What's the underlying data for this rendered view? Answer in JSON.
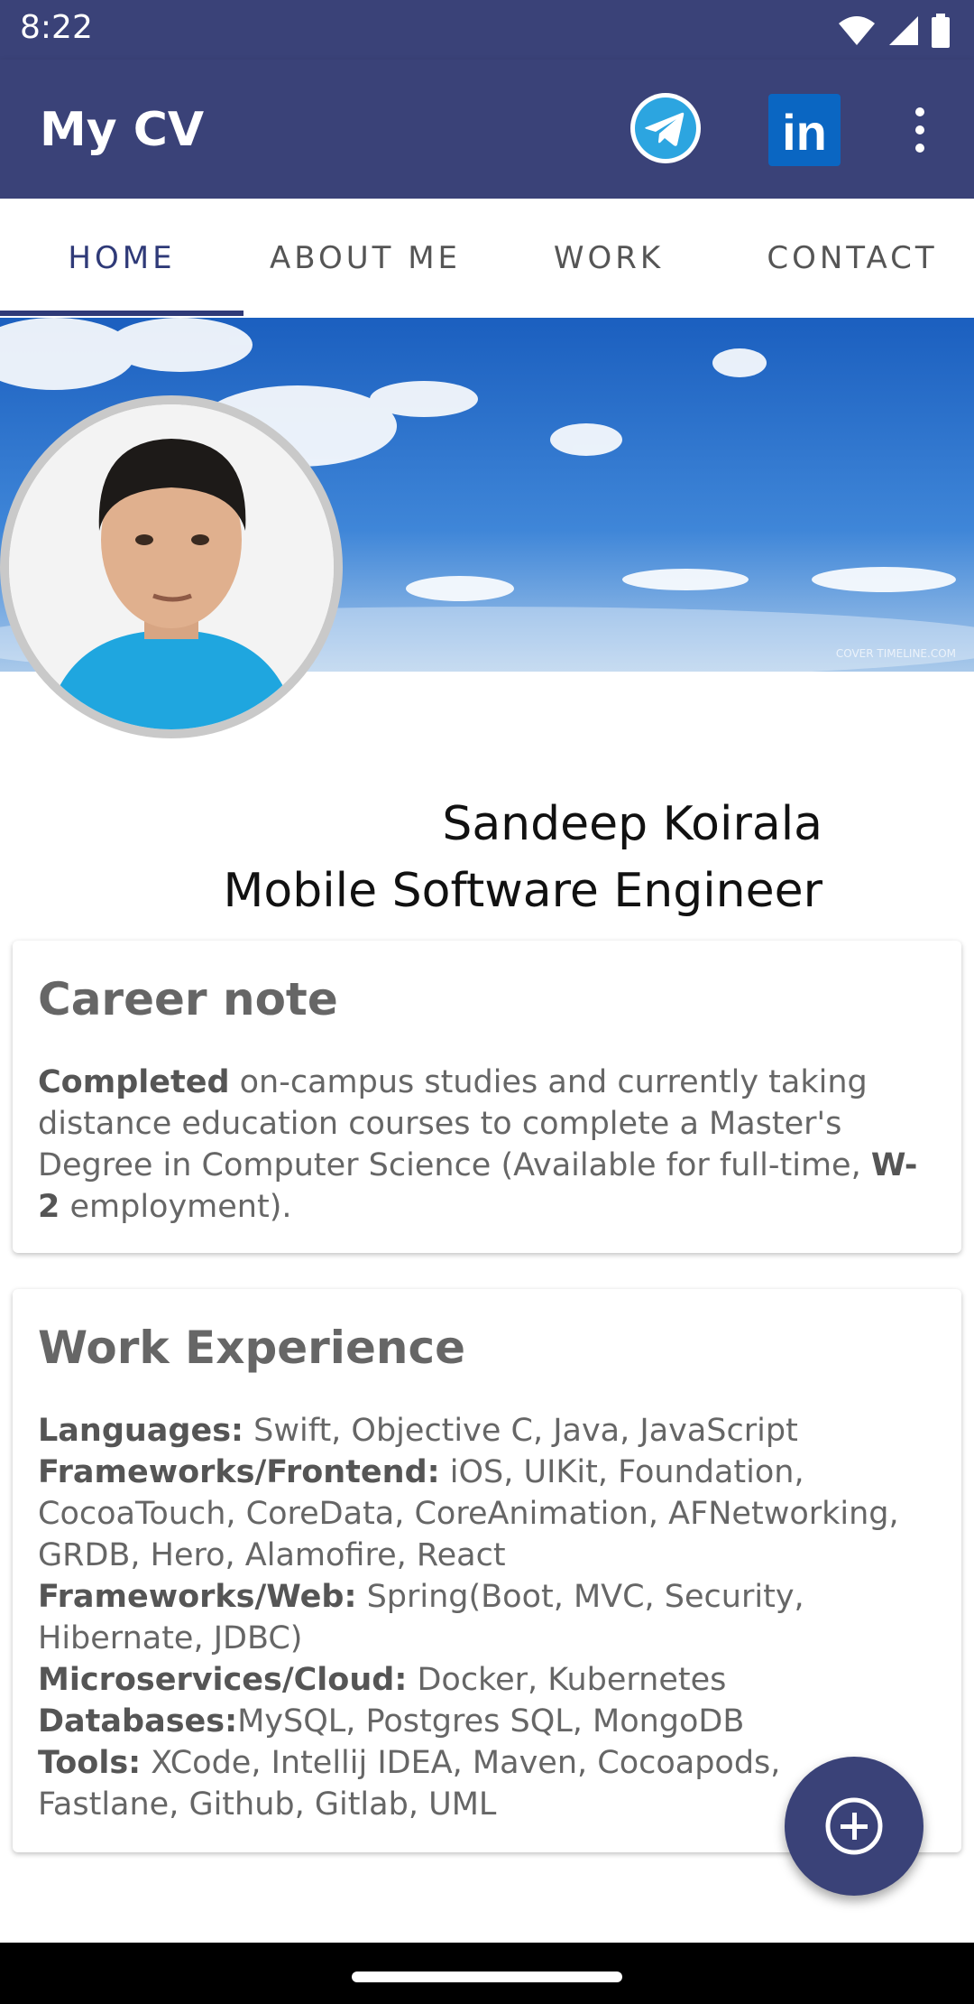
{
  "status_bar": {
    "time": "8:22"
  },
  "app_bar": {
    "title": "My CV",
    "linkedin_text": "in"
  },
  "tabs": [
    {
      "label": "HOME"
    },
    {
      "label": "ABOUT ME"
    },
    {
      "label": "WORK"
    },
    {
      "label": "CONTACT"
    }
  ],
  "banner": {
    "watermark": "COVER TIMELINE.COM"
  },
  "profile": {
    "name": "Sandeep Koirala",
    "role": "Mobile Software Engineer"
  },
  "career_note": {
    "heading": "Career note",
    "bold_1": "Completed",
    "text_1": " on-campus studies and currently taking distance education courses to complete a Master's Degree in Computer Science (Available for full-time, ",
    "bold_2": "W-2",
    "text_2": " employment)."
  },
  "work_experience": {
    "heading": "Work Experience",
    "lines": [
      {
        "label": "Languages:",
        "value": " Swift, Objective C, Java, JavaScript"
      },
      {
        "label": "Frameworks/Frontend:",
        "value": " iOS, UIKit, Foundation, CocoaTouch, CoreData, CoreAnimation, AFNetworking, GRDB, Hero, Alamofire, React"
      },
      {
        "label": "Frameworks/Web:",
        "value": " Spring(Boot, MVC, Security, Hibernate, JDBC)"
      },
      {
        "label": "Microservices/Cloud:",
        "value": " Docker, Kubernetes"
      },
      {
        "label": "Databases:",
        "value": "MySQL, Postgres SQL, MongoDB"
      },
      {
        "label": "Tools:",
        "value": " XCode, Intellij IDEA, Maven, Cocoapods, Fastlane, Github, Gitlab, UML"
      }
    ]
  },
  "colors": {
    "primary": "#3a4278",
    "tab_active": "#2f3a78",
    "telegram": "#2ca5e0",
    "linkedin": "#0a66c2"
  },
  "icons": [
    "wifi-icon",
    "signal-icon",
    "battery-icon",
    "telegram-icon",
    "linkedin-icon",
    "more-vert-icon",
    "add-circle-icon"
  ]
}
